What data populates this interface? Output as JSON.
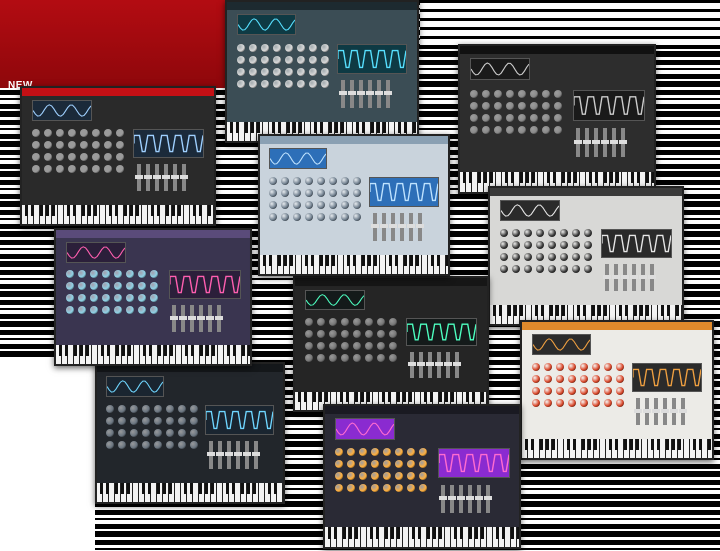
{
  "banner": {
    "new_label": "NEW"
  },
  "panels": [
    {
      "name": "dark-red-synth-panel",
      "bg": "#2a2a2a",
      "bar": "#c41015",
      "screen": "#1b2a3a",
      "wave": "#9fd0ff",
      "knob": "#9a9a9a"
    },
    {
      "name": "teal-multi-synth-panel",
      "bg": "#3b4d55",
      "bar": "#1d2a30",
      "screen": "#0e3a44",
      "wave": "#57e0ff",
      "knob": "#d8d8d8"
    },
    {
      "name": "dark-gray-synth-panel",
      "bg": "#2d2d2d",
      "bar": "#111111",
      "screen": "#1a1a1a",
      "wave": "#cccccc",
      "knob": "#8a8a8a"
    },
    {
      "name": "light-blue-synth-panel",
      "bg": "#c9d3dc",
      "bar": "#8aa0b3",
      "screen": "#2d6fb8",
      "wave": "#bfe3ff",
      "knob": "#6f7f8e"
    },
    {
      "name": "white-analog-synth-panel",
      "bg": "#d8d8d6",
      "bar": "#3a3a3a",
      "screen": "#2a2a2a",
      "wave": "#e6e6e6",
      "knob": "#3a3a3a"
    },
    {
      "name": "purple-synth-panel",
      "bg": "#3a3550",
      "bar": "#5a4b7a",
      "screen": "#2b1f3a",
      "wave": "#ff5fb0",
      "knob": "#8fd2e6"
    },
    {
      "name": "black-synth-panel-center",
      "bg": "#252525",
      "bar": "#161616",
      "screen": "#141a1a",
      "wave": "#4dffc0",
      "knob": "#777777"
    },
    {
      "name": "orange-white-synth-panel",
      "bg": "#ecebe7",
      "bar": "#e08a2c",
      "screen": "#2b2b2b",
      "wave": "#f0a040",
      "knob": "#d9472a"
    },
    {
      "name": "dark-blue-synth-panel",
      "bg": "#22262b",
      "bar": "#14171a",
      "screen": "#1a2530",
      "wave": "#6fd6ff",
      "knob": "#6a7580"
    },
    {
      "name": "colorful-modular-synth-panel",
      "bg": "#2a2a35",
      "bar": "#1a1a22",
      "screen": "#8a2bd0",
      "wave": "#ff6bd0",
      "knob": "#ffb040"
    }
  ]
}
